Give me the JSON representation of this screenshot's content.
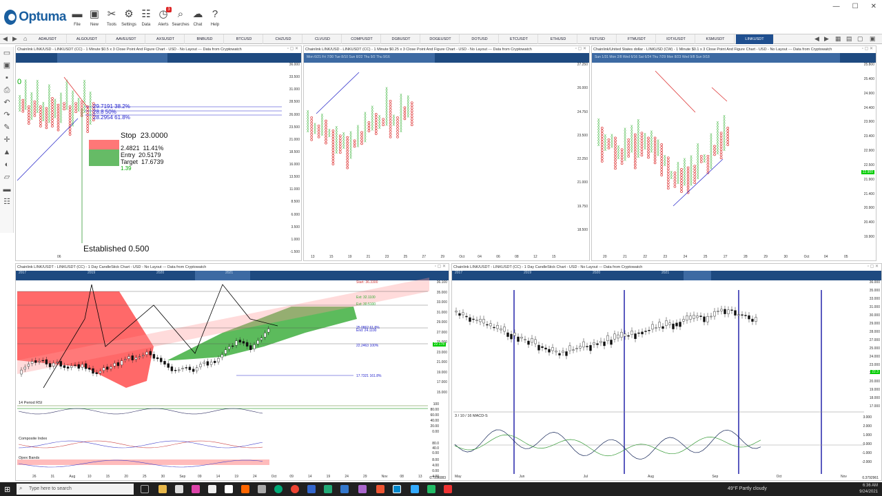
{
  "app": {
    "name": "Optuma"
  },
  "toolbar": [
    {
      "label": "File",
      "icon": "folder-icon"
    },
    {
      "label": "New",
      "icon": "new-window-icon"
    },
    {
      "label": "Tools",
      "icon": "tools-icon"
    },
    {
      "label": "Settings",
      "icon": "gear-icon"
    },
    {
      "label": "Data",
      "icon": "data-icon"
    },
    {
      "label": "Alerts",
      "icon": "alarm-clock-icon",
      "badge": "3"
    },
    {
      "label": "Searches",
      "icon": "search-icon"
    },
    {
      "label": "Chat",
      "icon": "chat-icon"
    },
    {
      "label": "Help",
      "icon": "help-icon"
    }
  ],
  "tabs": [
    "ADAUSDT",
    "ALGOUSDT",
    "AAVEUSDT",
    "AXSUSDT",
    "BNBUSD",
    "BTCUSD",
    "CHZUSD",
    "CLVUSD",
    "COMPUSDT",
    "DGBUSDT",
    "DOGEUSDT",
    "DOTUSD",
    "ETCUSDT",
    "ETHUSD",
    "FETUSD",
    "FTMUSDT",
    "IOTXUSDT",
    "KSMUSDT",
    "LINKUSDT"
  ],
  "active_tab": "LINKUSDT",
  "panes": {
    "p1": {
      "title": "Chainlink LINK/USD - LINKUSDT (CC) - 1 Minute $0.5 x 3 Close Point And Figure Chart - USD - No Layout --- Data from Cryptowatch",
      "yticks": [
        "36.000",
        "33.500",
        "31.000",
        "28.500",
        "26.000",
        "23.500",
        "21.000",
        "18.500",
        "16.000",
        "13.500",
        "11.000",
        "8.500",
        "6.000",
        "3.500",
        "1.000",
        "-1.500"
      ],
      "xticks": [
        "06"
      ],
      "fib": [
        {
          "v": "29.7191",
          "p": "38.2%"
        },
        {
          "v": "28.8",
          "p": "50%"
        },
        {
          "v": "28.2954",
          "p": "61.8%"
        }
      ],
      "stop_label": "Stop",
      "stop_value": "23.0000",
      "risk": "2.4821",
      "risk_pct": "11.41%",
      "entry_label": "Entry",
      "entry_value": "20.5179",
      "target_label": "Target",
      "target_value": "17.6739",
      "ratio": "1.39",
      "established": "Established 0.500",
      "left_label": "0"
    },
    "p2": {
      "title": "Chainlink LINK/USD - LINKUSDT (CC) - 1 Minute $0.25 x 3 Close Point And Figure Chart - USD - No Layout --- Data from Cryptowatch",
      "header_dates": "Mon 6/21  Fri 7/30  Tue 8/10  Sun 8/22  Thu 9/2  Thu 9/16",
      "yticks": [
        "27.250",
        "26.000",
        "24.750",
        "23.500",
        "22.250",
        "21.000",
        "19.750",
        "18.500"
      ],
      "xticks": [
        "13",
        "15",
        "19",
        "21",
        "23",
        "25",
        "27",
        "29",
        "Oct",
        "04",
        "06",
        "08",
        "12",
        "15"
      ]
    },
    "p3": {
      "title": "Chainlink/United States dollar - LINKUSD (CW) - 1 Minute $0.1 x 3 Close Point And Figure Chart - USD - No Layout --- Data from Cryptowatch",
      "header_dates": "Sun 1/31  Mon 2/8  Wed 6/16  Sat 6/24  Thu 7/29  Mon 8/23  Wed 9/8  Sun 9/18",
      "yticks": [
        "25.800",
        "25.400",
        "24.900",
        "24.400",
        "23.900",
        "23.400",
        "22.900",
        "22.500",
        "21.900",
        "21.400",
        "20.900",
        "20.400",
        "19.900"
      ],
      "price_label": "22.900",
      "xticks": [
        "20",
        "21",
        "22",
        "23",
        "24",
        "25",
        "27",
        "28",
        "29",
        "30",
        "Oct",
        "04",
        "05"
      ]
    },
    "p4": {
      "title": "Chainlink LINK/USDT - LINKUSDT (CC) - 1 Day CandleStick Chart - USD - No Layout --- Data from Cryptowatch",
      "years": [
        "2017",
        "2019",
        "2020",
        "2021"
      ],
      "yticks": [
        "36.100",
        "35.000",
        "33.000",
        "31.000",
        "29.000",
        "27.000",
        "25.000",
        "23.000",
        "21.000",
        "19.000",
        "17.000",
        "15.000"
      ],
      "price_label": "22.178",
      "levels": [
        {
          "label": "Start: 36.3300"
        },
        {
          "label": "Ext: 32.1100"
        },
        {
          "label": "Ext: 30.5100"
        },
        {
          "label": "25.0862  61.8%"
        },
        {
          "label": "End: 24.1100"
        },
        {
          "label": "22.2463  100%"
        },
        {
          "label": "17.7321  161.8%"
        }
      ],
      "rsi_label": "14 Period RSI",
      "rsi_ticks": [
        "100",
        "80.00",
        "60.00",
        "40.00",
        "20.00",
        "0.00"
      ],
      "ci_label": "Composite Index",
      "ci_ticks": [
        "80.0",
        "40.0",
        "0.00"
      ],
      "ob_label": "Opex Bands",
      "ob_ticks": [
        "8.00",
        "4.00",
        "0.00",
        "-4.00"
      ],
      "xticks": [
        "26",
        "31",
        "Aug",
        "10",
        "15",
        "20",
        "25",
        "30",
        "Sep",
        "09",
        "14",
        "19",
        "24",
        "Oct",
        "09",
        "14",
        "19",
        "24",
        "29",
        "Nov",
        "08",
        "13"
      ],
      "bottom_value": "0.7236083"
    },
    "p5": {
      "title": "Chainlink LINK/USDT - LINKUSDT (CC) - 1 Day CandleStick Chart - USD - No Layout --- Data from Cryptowatch",
      "years": [
        "2017",
        "2019",
        "2020",
        "2021"
      ],
      "yticks": [
        "36.000",
        "35.000",
        "33.000",
        "31.000",
        "30.000",
        "29.000",
        "28.000",
        "27.000",
        "25.000",
        "24.000",
        "23.000",
        "21.000",
        "20.000",
        "19.000",
        "18.000",
        "17.000"
      ],
      "price_label": "22.3",
      "macd_label": "3 / 10 / 16 MACD-S",
      "macd_ticks": [
        "3.000",
        "2.000",
        "1.000",
        "0.000",
        "-1.000",
        "-2.000"
      ],
      "xticks": [
        "May",
        "Jun",
        "Jul",
        "Aug",
        "Sep",
        "Oct",
        "Nov"
      ],
      "bottom_value": "0.3792961"
    }
  },
  "taskbar": {
    "search_placeholder": "Type here to search",
    "weather": "49°F  Partly cloudy",
    "time": "6:36 AM",
    "date": "9/24/2021"
  }
}
